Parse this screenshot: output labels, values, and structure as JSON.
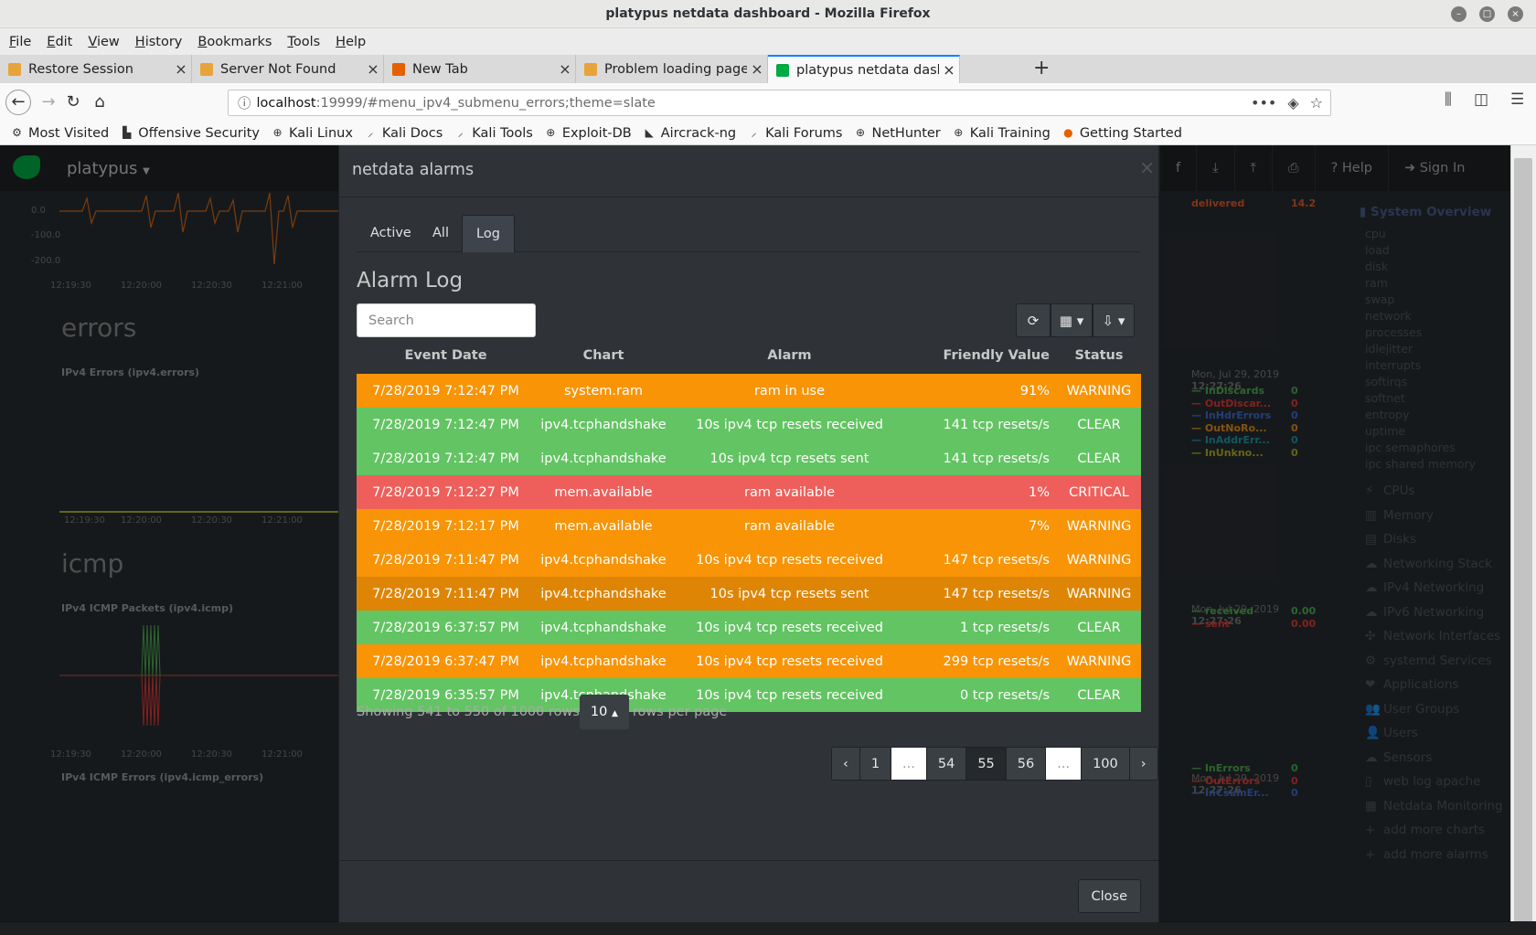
{
  "window": {
    "title": "platypus netdata dashboard - Mozilla Firefox"
  },
  "menubar": [
    {
      "u": "F",
      "rest": "ile"
    },
    {
      "u": "E",
      "rest": "dit"
    },
    {
      "u": "V",
      "rest": "iew"
    },
    {
      "u": "H",
      "rest": "istory"
    },
    {
      "u": "B",
      "rest": "ookmarks"
    },
    {
      "u": "T",
      "rest": "ools"
    },
    {
      "u": "H",
      "rest": "elp"
    }
  ],
  "tabs": [
    {
      "label": "Restore Session",
      "icon": "warning-page-icon",
      "color": "#e8a33c"
    },
    {
      "label": "Server Not Found",
      "icon": "warning-page-icon",
      "color": "#e8a33c"
    },
    {
      "label": "New Tab",
      "icon": "firefox-icon",
      "color": "#e66000"
    },
    {
      "label": "Problem loading page",
      "icon": "warning-page-icon",
      "color": "#e8a33c"
    },
    {
      "label": "platypus netdata dashboard",
      "icon": "netdata-icon",
      "color": "#00ab44"
    }
  ],
  "url": {
    "host": "localhost",
    "rest": ":19999/#menu_ipv4_submenu_errors;theme=slate"
  },
  "bookmarks": [
    {
      "label": "Most Visited",
      "icon": "gear-icon"
    },
    {
      "label": "Offensive Security",
      "icon": "offsec-icon"
    },
    {
      "label": "Kali Linux",
      "icon": "globe-icon"
    },
    {
      "label": "Kali Docs",
      "icon": "kali-icon"
    },
    {
      "label": "Kali Tools",
      "icon": "kali-icon"
    },
    {
      "label": "Exploit-DB",
      "icon": "globe-icon"
    },
    {
      "label": "Aircrack-ng",
      "icon": "aircrack-icon"
    },
    {
      "label": "Kali Forums",
      "icon": "kali-icon"
    },
    {
      "label": "NetHunter",
      "icon": "globe-icon"
    },
    {
      "label": "Kali Training",
      "icon": "globe-icon"
    },
    {
      "label": "Getting Started",
      "icon": "firefox-icon"
    }
  ],
  "netdata": {
    "host": "platypus",
    "right_buttons": [
      "Help",
      "Sign In"
    ],
    "sections": [
      "errors",
      "icmp"
    ],
    "chart_titles": [
      "IPv4 Errors (ipv4.errors)",
      "IPv4 ICMP Packets (ipv4.icmp)",
      "IPv4 ICMP Errors (ipv4.icmp_errors)"
    ],
    "times": [
      "12:19:30",
      "12:20:00",
      "12:20:30",
      "12:21:00"
    ],
    "yticks_top": [
      "0.0",
      "-100.0",
      "-200.0"
    ],
    "side_dates": [
      "Mon, Jul 29, 2019",
      "12:27:26"
    ],
    "legend_delivered": {
      "name": "delivered",
      "value": "14.2"
    },
    "errors_legend": [
      {
        "name": "InDiscards",
        "value": "0",
        "color": "#4caf50"
      },
      {
        "name": "OutDiscar...",
        "value": "0",
        "color": "#e53935"
      },
      {
        "name": "InHdrErrors",
        "value": "0",
        "color": "#3f6ccf"
      },
      {
        "name": "OutNoRo...",
        "value": "0",
        "color": "#e09020"
      },
      {
        "name": "InAddrErr...",
        "value": "0",
        "color": "#2196a6"
      },
      {
        "name": "InUnkno...",
        "value": "0",
        "color": "#b0b020"
      }
    ],
    "icmp_legend": [
      {
        "name": "received",
        "value": "0.00",
        "color": "#4caf50"
      },
      {
        "name": "sent",
        "value": "0.00",
        "color": "#e53935"
      }
    ],
    "icmp_errors_legend": [
      {
        "name": "InErrors",
        "value": "0",
        "color": "#4caf50"
      },
      {
        "name": "OutErrors",
        "value": "0",
        "color": "#e53935"
      },
      {
        "name": "InCsumEr...",
        "value": "0",
        "color": "#3f6ccf"
      }
    ],
    "menu": {
      "section": "System Overview",
      "subs": [
        "cpu",
        "load",
        "disk",
        "ram",
        "swap",
        "network",
        "processes",
        "idlejitter",
        "interrupts",
        "softirqs",
        "softnet",
        "entropy",
        "uptime",
        "ipc semaphores",
        "ipc shared memory"
      ],
      "tops": [
        "CPUs",
        "Memory",
        "Disks",
        "Networking Stack",
        "IPv4 Networking",
        "IPv6 Networking",
        "Network Interfaces",
        "systemd Services",
        "Applications",
        "User Groups",
        "Users",
        "Sensors",
        "web log apache",
        "Netdata Monitoring",
        "add more charts",
        "add more alarms"
      ]
    }
  },
  "modal": {
    "title": "netdata alarms",
    "tabs": [
      "Active",
      "All",
      "Log"
    ],
    "log_title": "Alarm Log",
    "search_placeholder": "Search",
    "columns": [
      "Event Date",
      "Chart",
      "Alarm",
      "Friendly Value",
      "Status"
    ],
    "rows": [
      {
        "date": "7/28/2019 7:12:47 PM",
        "chart": "system.ram",
        "alarm": "ram in use",
        "value": "91%",
        "status": "WARNING",
        "color": "#f89406"
      },
      {
        "date": "7/28/2019 7:12:47 PM",
        "chart": "ipv4.tcphandshake",
        "alarm": "10s ipv4 tcp resets received",
        "value": "141 tcp resets/s",
        "status": "CLEAR",
        "color": "#62c462"
      },
      {
        "date": "7/28/2019 7:12:47 PM",
        "chart": "ipv4.tcphandshake",
        "alarm": "10s ipv4 tcp resets sent",
        "value": "141 tcp resets/s",
        "status": "CLEAR",
        "color": "#62c462"
      },
      {
        "date": "7/28/2019 7:12:27 PM",
        "chart": "mem.available",
        "alarm": "ram available",
        "value": "1%",
        "status": "CRITICAL",
        "color": "#ee5f5b"
      },
      {
        "date": "7/28/2019 7:12:17 PM",
        "chart": "mem.available",
        "alarm": "ram available",
        "value": "7%",
        "status": "WARNING",
        "color": "#f89406"
      },
      {
        "date": "7/28/2019 7:11:47 PM",
        "chart": "ipv4.tcphandshake",
        "alarm": "10s ipv4 tcp resets received",
        "value": "147 tcp resets/s",
        "status": "WARNING",
        "color": "#f89406"
      },
      {
        "date": "7/28/2019 7:11:47 PM",
        "chart": "ipv4.tcphandshake",
        "alarm": "10s ipv4 tcp resets sent",
        "value": "147 tcp resets/s",
        "status": "WARNING",
        "color": "#df8505"
      },
      {
        "date": "7/28/2019 6:37:57 PM",
        "chart": "ipv4.tcphandshake",
        "alarm": "10s ipv4 tcp resets received",
        "value": "1 tcp resets/s",
        "status": "CLEAR",
        "color": "#62c462"
      },
      {
        "date": "7/28/2019 6:37:47 PM",
        "chart": "ipv4.tcphandshake",
        "alarm": "10s ipv4 tcp resets received",
        "value": "299 tcp resets/s",
        "status": "WARNING",
        "color": "#f89406"
      },
      {
        "date": "7/28/2019 6:35:57 PM",
        "chart": "ipv4.tcphandshake",
        "alarm": "10s ipv4 tcp resets received",
        "value": "0 tcp resets/s",
        "status": "CLEAR",
        "color": "#62c462"
      }
    ],
    "pagination": {
      "info": "Showing 541 to 550 of 1000 rows",
      "page_size": "10",
      "per_page_text": "rows per page",
      "pages": [
        "‹",
        "1",
        "...",
        "54",
        "55",
        "56",
        "...",
        "100",
        "›"
      ],
      "current": "55"
    },
    "close_label": "Close"
  }
}
